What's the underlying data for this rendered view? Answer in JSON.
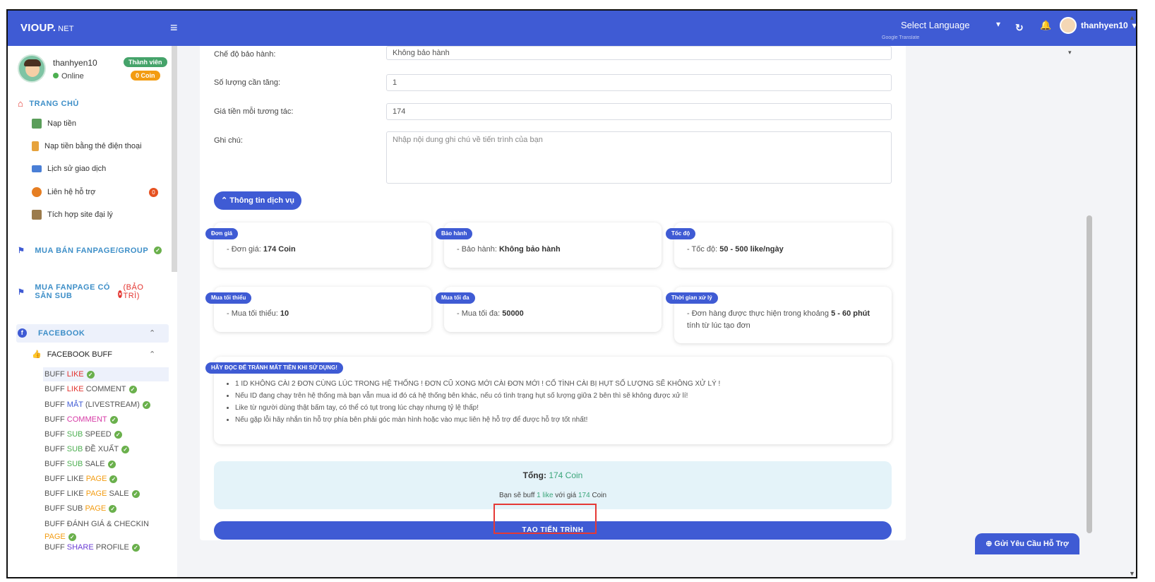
{
  "topbar": {
    "brand": "VIOUP.",
    "brand_suffix": "NET",
    "language": "Select Language",
    "translate_note": "Google Translate",
    "username": "thanhyen10"
  },
  "profile": {
    "name": "thanhyen10",
    "status": "Online",
    "role_badge": "Thành viên",
    "coin_badge": "0 Coin"
  },
  "sidebar": {
    "home_title": "TRANG CHỦ",
    "items": [
      {
        "label": "Nạp tiền"
      },
      {
        "label": "Nạp tiền bằng thẻ điện thoại"
      },
      {
        "label": "Lịch sử giao dịch"
      },
      {
        "label": "Liên hệ hỗ trợ",
        "count": "0"
      },
      {
        "label": "Tích hợp site đại lý"
      }
    ],
    "sections": [
      {
        "label": "MUA BÁN FANPAGE/GROUP"
      },
      {
        "label": "MUA FANPAGE CÓ SẴN SUB",
        "status": "(BẢO TRÌ)"
      }
    ],
    "facebook": "FACEBOOK",
    "facebook_buff": "FACEBOOK BUFF",
    "buff_items": [
      {
        "pre": "BUFF ",
        "hl": "LIKE",
        "post": "",
        "color": "red"
      },
      {
        "pre": "BUFF ",
        "hl": "LIKE",
        "post": " COMMENT",
        "color": "red"
      },
      {
        "pre": "BUFF ",
        "hl": "MẮT",
        "post": " (LIVESTREAM)",
        "color": "blue"
      },
      {
        "pre": "BUFF ",
        "hl": "COMMENT",
        "post": "",
        "color": "pink"
      },
      {
        "pre": "BUFF ",
        "hl": "SUB",
        "post": " SPEED",
        "color": "green"
      },
      {
        "pre": "BUFF ",
        "hl": "SUB",
        "post": " ĐỀ XUẤT",
        "color": "green"
      },
      {
        "pre": "BUFF ",
        "hl": "SUB",
        "post": " SALE",
        "color": "green"
      },
      {
        "pre": "BUFF LIKE ",
        "hl": "PAGE",
        "post": "",
        "color": "orange"
      },
      {
        "pre": "BUFF LIKE ",
        "hl": "PAGE",
        "post": " SALE",
        "color": "orange"
      },
      {
        "pre": "BUFF SUB ",
        "hl": "PAGE",
        "post": "",
        "color": "orange"
      },
      {
        "pre": "BUFF ĐÁNH GIÁ & CHECKIN",
        "hl": "PAGE",
        "post": "",
        "color": "orange"
      },
      {
        "pre": "BUFF ",
        "hl": "SHARE",
        "post": " PROFILE",
        "color": "purple"
      }
    ]
  },
  "form": {
    "warranty_label": "Chế độ bảo hành:",
    "warranty_value": "Không bảo hành",
    "quantity_label": "Số lượng cần tăng:",
    "quantity_value": "1",
    "price_label": "Giá tiền mỗi tương tác:",
    "price_value": "174",
    "note_label": "Ghi chú:",
    "note_placeholder": "Nhập nội dung ghi chú về tiến trình của bạn"
  },
  "info_button": "Thông tin dịch vụ",
  "info_cards": [
    {
      "badge": "Đơn giá",
      "prefix": "- Đơn giá: ",
      "value": "174 Coin",
      "suffix": ""
    },
    {
      "badge": "Bảo hành",
      "prefix": "- Bảo hành: ",
      "value": "Không bảo hành",
      "suffix": ""
    },
    {
      "badge": "Tốc độ",
      "prefix": "- Tốc độ: ",
      "value": "50 - 500 like/ngày",
      "suffix": ""
    },
    {
      "badge": "Mua tối thiểu",
      "prefix": "- Mua tối thiểu: ",
      "value": "10",
      "suffix": ""
    },
    {
      "badge": "Mua tối đa",
      "prefix": "- Mua tối đa: ",
      "value": "50000",
      "suffix": ""
    },
    {
      "badge": "Thời gian xử lý",
      "prefix": "- Đơn hàng được thực hiện trong khoảng ",
      "value": "5 - 60 phút",
      "suffix": " tính từ lúc tạo đơn"
    }
  ],
  "notice": {
    "badge": "HÃY ĐỌC ĐỂ TRÁNH MẤT TIỀN KHI SỬ DỤNG!",
    "items": [
      "1 ID KHÔNG CÀI 2 ĐƠN CÙNG LÚC TRONG HỆ THỐNG ! ĐƠN CŨ XONG MỚI CÀI ĐƠN MỚI ! CỐ TÌNH CÀI BỊ HỤT SỐ LƯỢNG SẼ KHÔNG XỬ LÝ !",
      "Nếu ID đang chạy trên hệ thống mà bạn vẫn mua id đó cá hệ thống bên khác, nếu có tình trạng hụt số lượng giữa 2 bên thì sẽ không được xử lí!",
      "Like từ người dùng thật bấm tay, có thể có tụt trong lúc chạy nhưng tỷ lệ thấp!",
      "Nếu gặp lỗi hãy nhắn tin hỗ trợ phía bên phải góc màn hình hoặc vào mục liên hệ hỗ trợ để được hỗ trợ tốt nhất!"
    ]
  },
  "total": {
    "label": "Tổng:",
    "amount": "174 Coin",
    "sub_pre": "Bạn sẽ buff ",
    "sub_qty": "1 like",
    "sub_mid": " với giá ",
    "sub_price": "174",
    "sub_post": " Coin"
  },
  "create_button": "TẠO TIẾN TRÌNH",
  "support_button": "Gửi Yêu Cầu Hỗ Trợ"
}
